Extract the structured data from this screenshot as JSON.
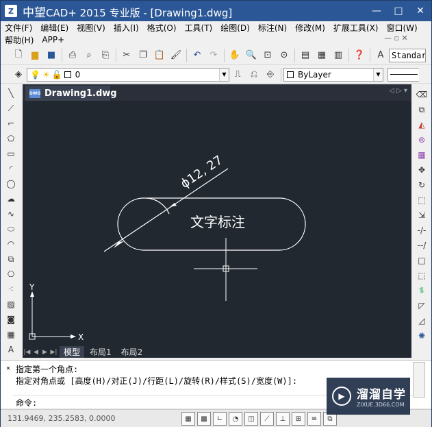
{
  "window": {
    "brand": "中望",
    "title": "CAD+ 2015 专业版 - [Drawing1.dwg]",
    "minimize": "—",
    "maximize": "□",
    "close": "✕"
  },
  "menu": {
    "row1": [
      "文件(F)",
      "编辑(E)",
      "视图(V)",
      "插入(I)",
      "格式(O)",
      "工具(T)",
      "绘图(D)",
      "标注(N)",
      "修改(M)",
      "扩展工具(X)",
      "窗口(W)"
    ],
    "row2": [
      "帮助(H)",
      "APP+"
    ],
    "mdi_controls": "—  ▫  ✕"
  },
  "toolbar1": {
    "text_style": "Standard"
  },
  "toolbar2": {
    "layer_value": "0",
    "color_value": "ByLayer"
  },
  "document": {
    "tab_label": "Drawing1.dwg",
    "dwg_badge": "DWG",
    "tab_nav": "◁ ▷ ▾"
  },
  "drawing": {
    "dimension_text": "ϕ12, 27",
    "annotation_text": "文字标注",
    "ucs_x": "X",
    "ucs_y": "Y"
  },
  "layouts": {
    "tabs": [
      "模型",
      "布局1",
      "布局2"
    ]
  },
  "command": {
    "line1": "指定第一个角点:",
    "line2": "指定对角点或 [高度(H)/对正(J)/行距(L)/旋转(R)/样式(S)/宽度(W)]:",
    "prompt": "命令:"
  },
  "status": {
    "coords": "131.9469,  235.2583,  0.0000"
  },
  "watermark": {
    "name": "溜溜自学",
    "url": "ZIXUE.3D66.COM"
  },
  "colors": {
    "titlebar": "#2b5797",
    "canvas": "#212830",
    "geometry": "#ffffff"
  }
}
